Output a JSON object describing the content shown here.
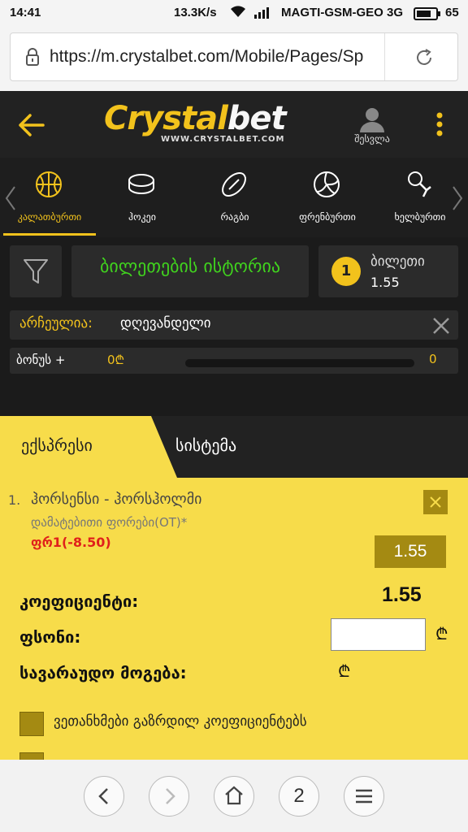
{
  "status_bar": {
    "time": "14:41",
    "speed": "13.3K/s",
    "carrier": "MAGTI-GSM-GEO 3G",
    "battery": "65"
  },
  "browser": {
    "url": "https://m.crystalbet.com/Mobile/Pages/Sp",
    "tabs_count": "2"
  },
  "header": {
    "logo_part1": "Crystal",
    "logo_part2": "bet",
    "logo_sub": "WWW.CRYSTALBET.COM",
    "user_label": "შესვლა"
  },
  "sports": [
    {
      "label": "კალათბურთი",
      "icon": "basketball-icon",
      "active": true
    },
    {
      "label": "ჰოკეი",
      "icon": "hockey-puck-icon",
      "active": false
    },
    {
      "label": "რაგბი",
      "icon": "rugby-ball-icon",
      "active": false
    },
    {
      "label": "ფრენბურთი",
      "icon": "volleyball-icon",
      "active": false
    },
    {
      "label": "ხელბურთი",
      "icon": "handball-icon",
      "active": false
    }
  ],
  "toolbar": {
    "history": "ბილეთების ისტორია",
    "ticket_badge": "1",
    "ticket_label": "ბილეთი",
    "ticket_odds": "1.55"
  },
  "archive": {
    "label": "არჩეულია:",
    "value": "დღევანდელი"
  },
  "bonus": {
    "label": "ბონუს +",
    "min": "0₾",
    "max": "0"
  },
  "bet_tabs": {
    "express": "ექსპრესი",
    "system": "სისტემა"
  },
  "slip": {
    "number": "1.",
    "match": "ჰორსენსი - ჰორსჰოლმი",
    "market": "დამატებითი ფორები(OT)*",
    "selection": "ფრ1(-8.50)",
    "odds": "1.55"
  },
  "summary": {
    "coef_label": "კოეფიციენტი:",
    "coef_value": "1.55",
    "stake_label": "ფსონი:",
    "currency": "₾",
    "win_label": "სავარაუდო მოგება:"
  },
  "options": [
    {
      "label": "ვეთანხმები გაზრდილ კოეფიციენტებს"
    }
  ],
  "colors": {
    "accent": "#f2c21c",
    "slip_bg": "#f7dc4a",
    "dark_bg": "#1b1b1b",
    "history_green": "#40d31e",
    "selection_red": "#e0201b"
  }
}
